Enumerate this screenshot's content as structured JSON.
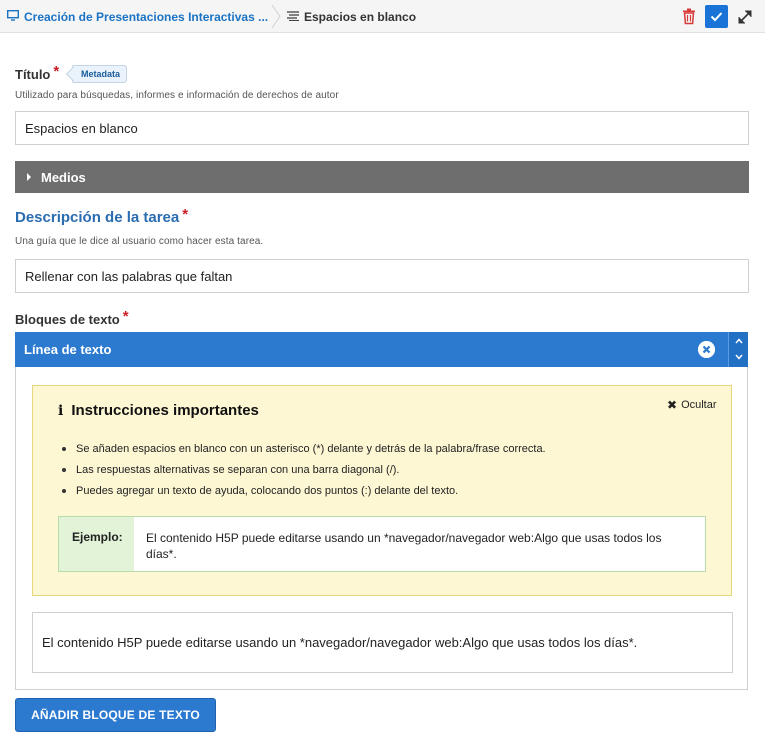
{
  "topbar": {
    "breadcrumb_parent": "Creación de Presentaciones Interactivas ...",
    "breadcrumb_current": "Espacios en blanco",
    "icons": [
      "presentation-icon",
      "list-icon",
      "trash-icon",
      "check-icon",
      "fullscreen-icon"
    ]
  },
  "title_field": {
    "label": "Título",
    "required_mark": "*",
    "metadata_button": "Metadata",
    "help": "Utilizado para búsquedas, informes e información de derechos de autor",
    "value": "Espacios en blanco"
  },
  "media": {
    "label": "Medios"
  },
  "task_description": {
    "label": "Descripción de la tarea",
    "required_mark": "*",
    "help": "Una guía que le dice al usuario como hacer esta tarea.",
    "value": "Rellenar con las palabras que faltan"
  },
  "text_blocks": {
    "label": "Bloques de texto",
    "required_mark": "*",
    "item_header": "Línea de texto",
    "instructions": {
      "title": "Instrucciones importantes",
      "hide_label": "Ocultar",
      "items": [
        "Se añaden espacios en blanco con un asterisco (*) delante y detrás de la palabra/frase correcta.",
        "Las respuestas alternativas se separan con una barra diagonal (/).",
        "Puedes agregar un texto de ayuda, colocando dos puntos (:) delante del texto."
      ],
      "example_label": "Ejemplo:",
      "example_text": "El contenido H5P puede editarse usando un *navegador/navegador web:Algo que usas todos los días*."
    },
    "value": "El contenido H5P puede editarse usando un *navegador/navegador web:Algo que usas todos los días*.",
    "add_button": "AÑADIR BLOQUE DE TEXTO"
  },
  "colors": {
    "accent_blue": "#2c7ad0",
    "link_blue": "#1a73c4",
    "required_red": "#c81d25",
    "instructions_bg": "#fdf7d4",
    "example_bg": "#e2f3d8",
    "media_bar": "#6e6e6e"
  }
}
